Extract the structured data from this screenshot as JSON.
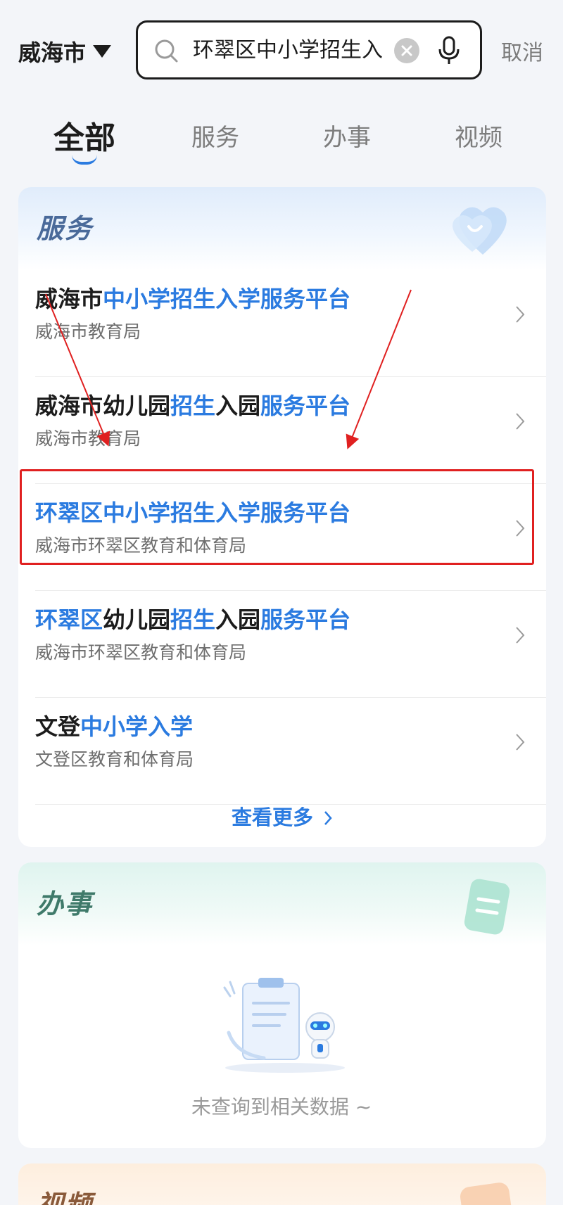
{
  "header": {
    "city": "威海市",
    "search_query": "环翠区中小学招生入",
    "cancel_label": "取消"
  },
  "tabs": [
    {
      "label": "全部",
      "active": true
    },
    {
      "label": "服务",
      "active": false
    },
    {
      "label": "办事",
      "active": false
    },
    {
      "label": "视频",
      "active": false
    }
  ],
  "services": {
    "title": "服务",
    "items": [
      {
        "title_parts": [
          {
            "t": "威海市",
            "hl": false
          },
          {
            "t": "中小学招生入学服务平台",
            "hl": true
          }
        ],
        "subtitle": "威海市教育局"
      },
      {
        "title_parts": [
          {
            "t": "威海市幼儿园",
            "hl": false
          },
          {
            "t": "招生",
            "hl": true
          },
          {
            "t": "入园",
            "hl": false
          },
          {
            "t": "服务平台",
            "hl": true
          }
        ],
        "subtitle": "威海市教育局"
      },
      {
        "title_parts": [
          {
            "t": "环翠区中小学招生入学服务平台",
            "hl": true
          }
        ],
        "subtitle": "威海市环翠区教育和体育局"
      },
      {
        "title_parts": [
          {
            "t": "环翠区",
            "hl": true
          },
          {
            "t": "幼儿园",
            "hl": false
          },
          {
            "t": "招生",
            "hl": true
          },
          {
            "t": "入园",
            "hl": false
          },
          {
            "t": "服务平台",
            "hl": true
          }
        ],
        "subtitle": "威海市环翠区教育和体育局"
      },
      {
        "title_parts": [
          {
            "t": "文登",
            "hl": false
          },
          {
            "t": "中小学入学",
            "hl": true
          }
        ],
        "subtitle": "文登区教育和体育局"
      }
    ],
    "more_label": "查看更多"
  },
  "tasks": {
    "title": "办事",
    "empty_text": "未查询到相关数据 ~"
  },
  "videos": {
    "title": "视频"
  },
  "colors": {
    "accent": "#2b7be0",
    "annotation": "#e02020"
  }
}
